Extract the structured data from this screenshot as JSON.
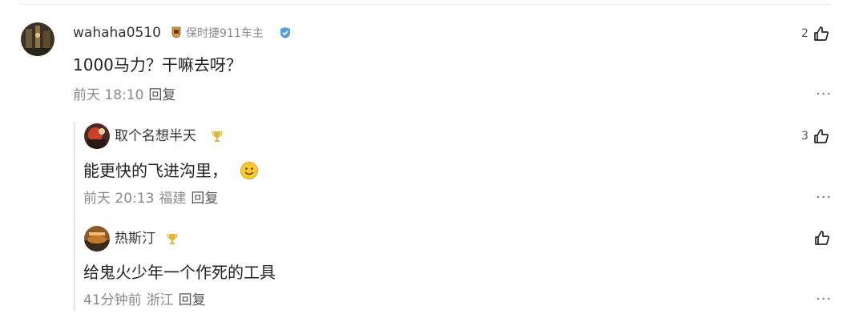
{
  "comments": [
    {
      "author": "wahaha0510",
      "car_badge": "保时捷911车主",
      "text": "1000马力？干嘛去呀？",
      "time": "前天 18:10",
      "location": "",
      "reply_label": "回复",
      "likes": "2",
      "more": "···"
    },
    {
      "author": "取个名想半天",
      "text": "能更快的飞进沟里，",
      "emoji": "smile-emoji",
      "time": "前天 20:13",
      "location": "福建",
      "reply_label": "回复",
      "likes": "3",
      "more": "···"
    },
    {
      "author": "热斯汀",
      "text": "给鬼火少年一个作死的工具",
      "time": "41分钟前",
      "location": "浙江",
      "reply_label": "回复",
      "likes": "",
      "more": "···"
    }
  ],
  "colors": {
    "meta": "#8a8a8a",
    "trophy": "#e0b83a",
    "badge_blue": "#5aa0d8"
  }
}
